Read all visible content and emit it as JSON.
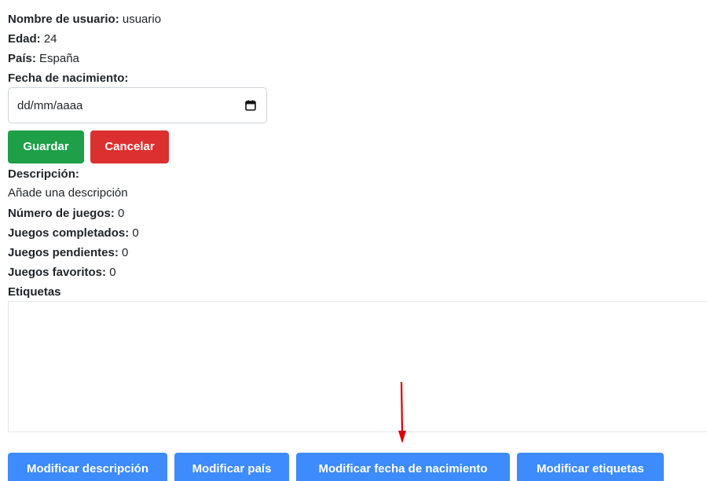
{
  "profile": {
    "username_label": "Nombre de usuario:",
    "username_value": " usuario",
    "age_label": "Edad:",
    "age_value": " 24",
    "country_label": "País:",
    "country_value": " España",
    "birthdate_label": "Fecha de nacimiento:"
  },
  "birthdate_input": {
    "value": "dd/mm/aaaa",
    "icon": "calendar-icon"
  },
  "edit_actions": {
    "save_label": "Guardar",
    "cancel_label": "Cancelar"
  },
  "description": {
    "label": "Descripción:",
    "value": "Añade una descripción"
  },
  "stats": {
    "games_count_label": "Número de juegos:",
    "games_count_value": " 0",
    "completed_label": "Juegos completados:",
    "completed_value": " 0",
    "pending_label": "Juegos pendientes:",
    "pending_value": " 0",
    "favorites_label": "Juegos favoritos:",
    "favorites_value": " 0"
  },
  "tags": {
    "label": "Etiquetas"
  },
  "bottom_actions": {
    "modify_description": "Modificar descripción",
    "modify_country": "Modificar país",
    "modify_birthdate": "Modificar fecha de nacimiento",
    "modify_tags": "Modificar etiquetas"
  },
  "colors": {
    "success": "#1e9f48",
    "danger": "#dc3030",
    "primary": "#3d8bfd",
    "annotation_arrow": "#e00000"
  }
}
